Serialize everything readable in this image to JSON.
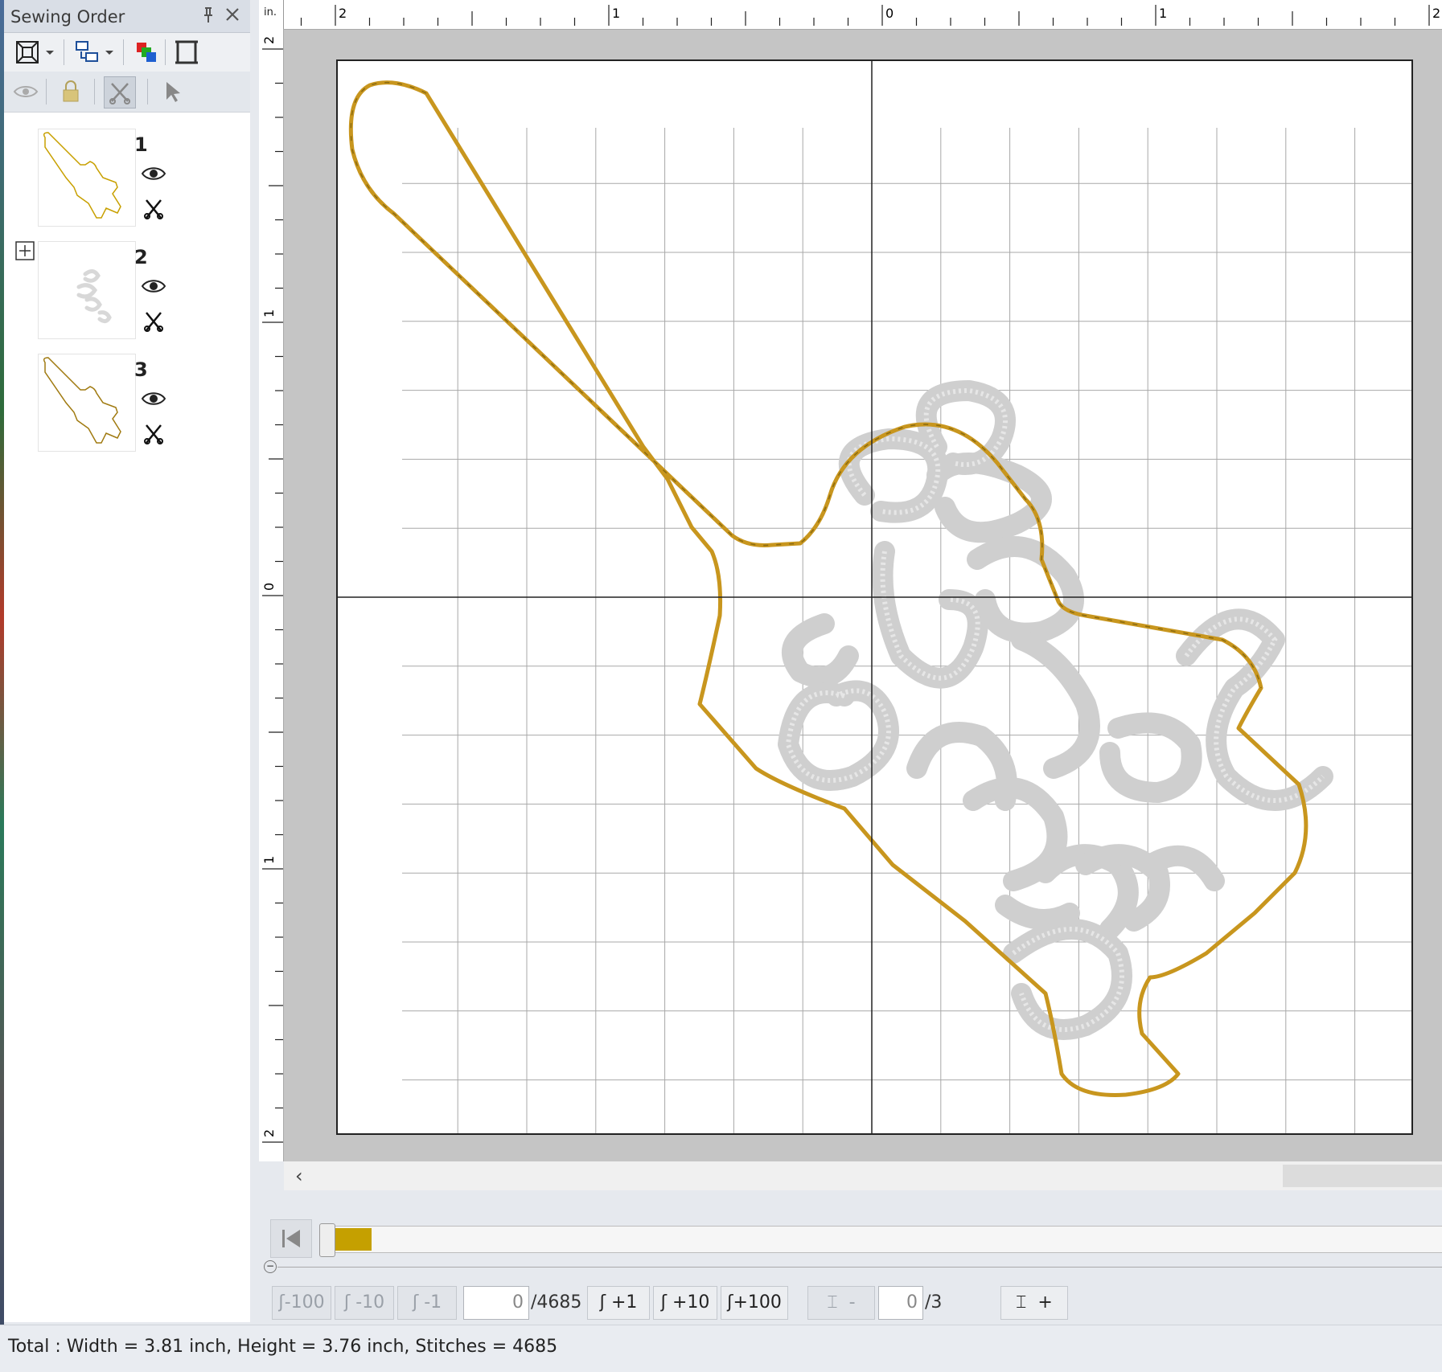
{
  "panel": {
    "title": "Sewing Order",
    "pin_icon": "pin-icon",
    "close_icon": "close-icon",
    "layers": [
      {
        "number": "1",
        "thumbnail": "guitar-outline-gold",
        "visible": true
      },
      {
        "number": "2",
        "thumbnail": "lettering-gray",
        "visible": true
      },
      {
        "number": "3",
        "thumbnail": "guitar-outline-dark-gold",
        "visible": true
      }
    ]
  },
  "ruler": {
    "unit": "in.",
    "top_labels": [
      "2",
      "1",
      "0",
      "1",
      "2"
    ],
    "left_labels": [
      "2",
      "1",
      "0",
      "1",
      "2"
    ]
  },
  "colors": {
    "outline": "#c8961e",
    "embroidery": "#c9c9c9",
    "progress_fill": "#c5a000",
    "grid": "#a8a8a8"
  },
  "progress": {
    "fraction": 0.04
  },
  "controls": {
    "minus100": "-100",
    "minus10": "-10",
    "minus1": "-1",
    "stitch_value": "0",
    "stitch_total": "/4685",
    "plus1": "+1",
    "plus10": "+10",
    "plus100": "+100",
    "color_minus": "-",
    "color_value": "0",
    "color_total": "/3",
    "color_plus": "+"
  },
  "status": {
    "text": "Total : Width = 3.81 inch, Height = 3.76 inch, Stitches = 4685"
  }
}
